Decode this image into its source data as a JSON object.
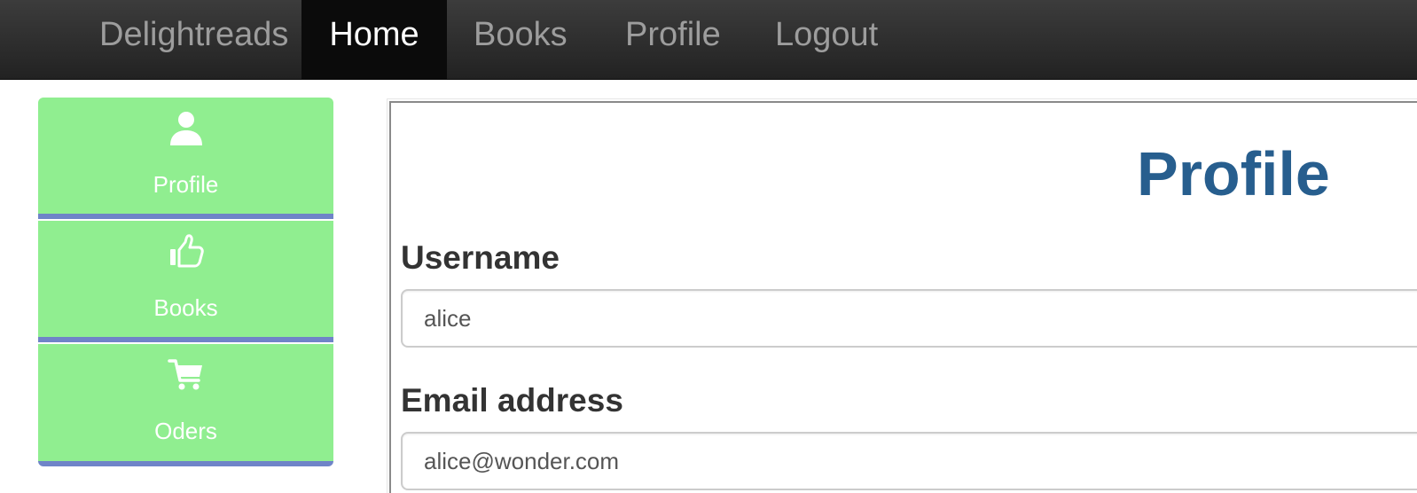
{
  "navbar": {
    "brand": "Delightreads",
    "links": [
      {
        "label": "Home",
        "active": true
      },
      {
        "label": "Books",
        "active": false
      },
      {
        "label": "Profile",
        "active": false
      },
      {
        "label": "Logout",
        "active": false
      }
    ]
  },
  "sidebar": {
    "items": [
      {
        "label": "Profile",
        "icon": "user-icon"
      },
      {
        "label": "Books",
        "icon": "thumbs-up-icon"
      },
      {
        "label": "Oders",
        "icon": "shopping-cart-icon"
      }
    ],
    "background_color": "#90ee90",
    "separator_color": "#6f84c8"
  },
  "main": {
    "title": "Profile",
    "title_color": "#275e8e",
    "fields": [
      {
        "label": "Username",
        "value": "alice"
      },
      {
        "label": "Email address",
        "value": "alice@wonder.com"
      }
    ]
  }
}
